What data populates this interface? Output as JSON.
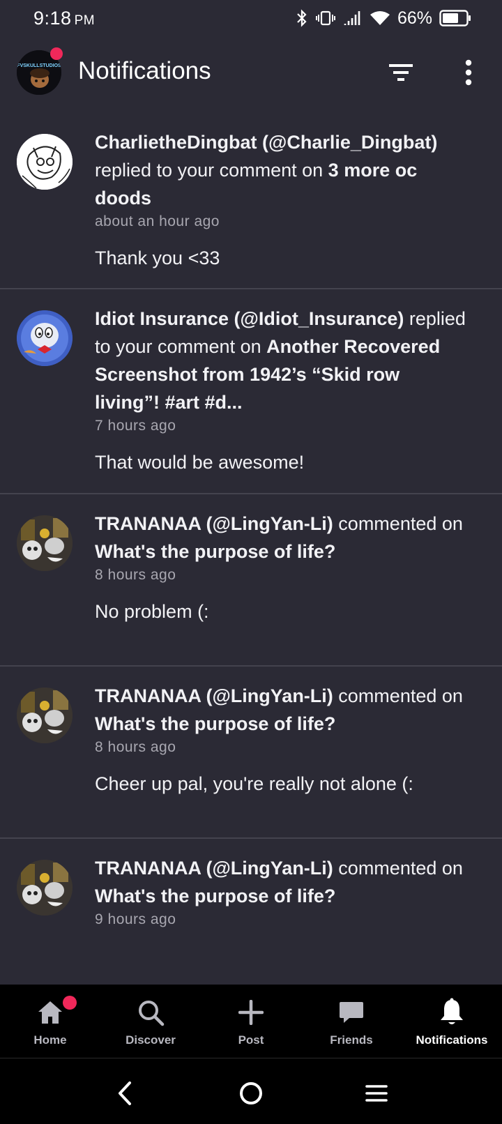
{
  "status_bar": {
    "time": "9:18",
    "ampm": "PM",
    "battery_percent": "66%"
  },
  "header": {
    "title": "Notifications",
    "avatar_badge_color": "#f0285a"
  },
  "notifications": [
    {
      "user": "CharlietheDingbat (@Charlie_Dingbat)",
      "action": " replied to your comment on ",
      "target": "3 more oc doods",
      "time": "about an hour ago",
      "message": "Thank you <33"
    },
    {
      "user": "Idiot Insurance (@Idiot_Insurance)",
      "action": " replied to your comment on ",
      "target": "Another Recovered Screenshot from 1942’s “Skid row living”! #art #d...",
      "time": "7 hours ago",
      "message": "That would be awesome!"
    },
    {
      "user": "TRANANAA (@LingYan-Li)",
      "action": " commented on ",
      "target": "What's the purpose of life?",
      "time": "8 hours ago",
      "message": "No problem (:"
    },
    {
      "user": "TRANANAA (@LingYan-Li)",
      "action": " commented on ",
      "target": "What's the purpose of life?",
      "time": "8 hours ago",
      "message": "Cheer up pal, you're really not alone (:"
    },
    {
      "user": "TRANANAA (@LingYan-Li)",
      "action": " commented on ",
      "target": "What's the purpose of life?",
      "time": "9 hours ago",
      "message": ""
    }
  ],
  "bottom_nav": {
    "home": "Home",
    "discover": "Discover",
    "post": "Post",
    "friends": "Friends",
    "notifications": "Notifications",
    "active": "notifications"
  },
  "colors": {
    "background": "#2b2a35",
    "nav_background": "#000000",
    "badge": "#f0285a",
    "divider": "#44434e"
  }
}
